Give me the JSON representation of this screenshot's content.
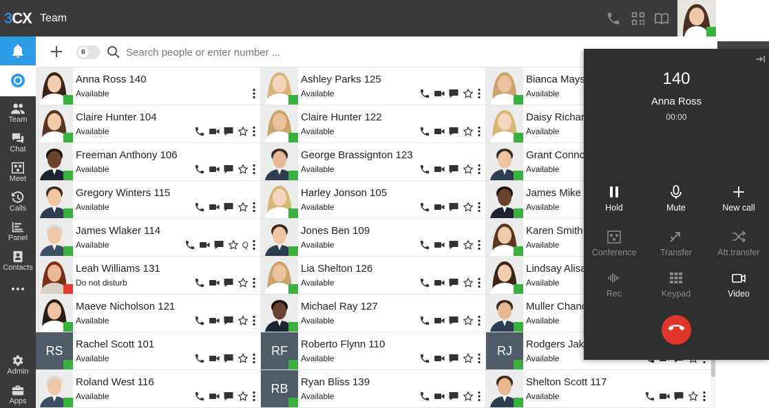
{
  "app": {
    "logo_prefix": "3",
    "logo_suffix": "CX",
    "title": "Team"
  },
  "colors": {
    "accent": "#2e9be6",
    "available": "#3ab03e",
    "dnd": "#e23b2e",
    "hangup": "#e0352b",
    "sidebar": "#3a3a3a",
    "panel": "#2f2f2f"
  },
  "sidebar": {
    "items": [
      {
        "label": "Team",
        "icon": "team-icon"
      },
      {
        "label": "Chat",
        "icon": "chat-icon"
      },
      {
        "label": "Meet",
        "icon": "meet-icon"
      },
      {
        "label": "Calls",
        "icon": "calls-icon"
      },
      {
        "label": "Panel",
        "icon": "panel-icon"
      },
      {
        "label": "Contacts",
        "icon": "contacts-icon"
      },
      {
        "label": "Admin",
        "icon": "gear-icon"
      },
      {
        "label": "Apps",
        "icon": "apps-icon"
      }
    ]
  },
  "toolbar": {
    "toggle_label": "B",
    "search_placeholder": "Search people or enter number ..."
  },
  "columns": [
    [
      {
        "name": "Anna Ross 140",
        "status": "Available",
        "initials": "",
        "avatar": "f1",
        "presence": "available",
        "actions": "more"
      },
      {
        "name": "Claire Hunter 104",
        "status": "Available",
        "initials": "",
        "avatar": "f2",
        "presence": "available",
        "actions": "full"
      },
      {
        "name": "Freeman Anthony 106",
        "status": "Available",
        "initials": "",
        "avatar": "m3",
        "presence": "available",
        "actions": "full"
      },
      {
        "name": "Gregory Winters 115",
        "status": "Available",
        "initials": "",
        "avatar": "m1",
        "presence": "available",
        "actions": "full"
      },
      {
        "name": "James Wlaker 114",
        "status": "Available",
        "initials": "",
        "avatar": "m4",
        "presence": "available",
        "actions": "fullq"
      },
      {
        "name": "Leah Williams 131",
        "status": "Do not disturb",
        "initials": "",
        "avatar": "f3",
        "presence": "dnd",
        "actions": "full"
      },
      {
        "name": "Maeve Nicholson 121",
        "status": "Available",
        "initials": "",
        "avatar": "f4",
        "presence": "available",
        "actions": "full"
      },
      {
        "name": "Rachel Scott 101",
        "status": "Available",
        "initials": "RS",
        "avatar": "",
        "presence": "available",
        "actions": "full"
      },
      {
        "name": "Roland West 116",
        "status": "Available",
        "initials": "",
        "avatar": "m4",
        "presence": "available",
        "actions": "full"
      }
    ],
    [
      {
        "name": "Ashley Parks 125",
        "status": "Available",
        "initials": "",
        "avatar": "f5",
        "presence": "available",
        "actions": "full"
      },
      {
        "name": "Claire Hunter 122",
        "status": "Available",
        "initials": "",
        "avatar": "f6",
        "presence": "available",
        "actions": "full"
      },
      {
        "name": "George Brassignton 123",
        "status": "Available",
        "initials": "",
        "avatar": "m2",
        "presence": "available",
        "actions": "full"
      },
      {
        "name": "Harley Jonson 105",
        "status": "Available",
        "initials": "",
        "avatar": "f5",
        "presence": "available",
        "actions": "full"
      },
      {
        "name": "Jones Ben 109",
        "status": "Available",
        "initials": "",
        "avatar": "m1",
        "presence": "available",
        "actions": "full"
      },
      {
        "name": "Lia Shelton 126",
        "status": "Available",
        "initials": "",
        "avatar": "f6",
        "presence": "available",
        "actions": "full"
      },
      {
        "name": "Michael Ray 127",
        "status": "Available",
        "initials": "",
        "avatar": "m3",
        "presence": "available",
        "actions": "full"
      },
      {
        "name": "Roberto Flynn 110",
        "status": "Available",
        "initials": "RF",
        "avatar": "",
        "presence": "available",
        "actions": "full"
      },
      {
        "name": "Ryan Bliss 139",
        "status": "Available",
        "initials": "RB",
        "avatar": "",
        "presence": "available",
        "actions": "full"
      }
    ],
    [
      {
        "name": "Bianca Mays",
        "status": "Available",
        "initials": "",
        "avatar": "f6",
        "presence": "available",
        "actions": "full"
      },
      {
        "name": "Daisy Richar",
        "status": "Available",
        "initials": "",
        "avatar": "f5",
        "presence": "available",
        "actions": "full"
      },
      {
        "name": "Grant Conno",
        "status": "Available",
        "initials": "",
        "avatar": "m1",
        "presence": "available",
        "actions": "full"
      },
      {
        "name": "James Mike",
        "status": "Available",
        "initials": "",
        "avatar": "m3",
        "presence": "available",
        "actions": "full"
      },
      {
        "name": "Karen Smith",
        "status": "Available",
        "initials": "",
        "avatar": "f2",
        "presence": "available",
        "actions": "full"
      },
      {
        "name": "Lindsay Alisa",
        "status": "Available",
        "initials": "",
        "avatar": "f1",
        "presence": "available",
        "actions": "full"
      },
      {
        "name": "Muller Chanc",
        "status": "Available",
        "initials": "",
        "avatar": "m2",
        "presence": "available",
        "actions": "full"
      },
      {
        "name": "Rodgers Jak",
        "status": "Available",
        "initials": "RJ",
        "avatar": "",
        "presence": "available",
        "actions": "full"
      },
      {
        "name": "Shelton Scott 117",
        "status": "Available",
        "initials": "",
        "avatar": "m2",
        "presence": "available",
        "actions": "full"
      }
    ]
  ],
  "call": {
    "number": "140",
    "name": "Anna Ross",
    "timer": "00:00",
    "buttons": [
      {
        "label": "Hold",
        "icon": "pause-icon",
        "enabled": true
      },
      {
        "label": "Mute",
        "icon": "microphone-icon",
        "enabled": true
      },
      {
        "label": "New call",
        "icon": "plus-icon",
        "enabled": true
      },
      {
        "label": "Conference",
        "icon": "conference-icon",
        "enabled": false
      },
      {
        "label": "Transfer",
        "icon": "transfer-icon",
        "enabled": false
      },
      {
        "label": "Att.transfer",
        "icon": "shuffle-icon",
        "enabled": false
      },
      {
        "label": "Rec",
        "icon": "waveform-icon",
        "enabled": false
      },
      {
        "label": "Keypad",
        "icon": "keypad-icon",
        "enabled": false
      },
      {
        "label": "Video",
        "icon": "video-icon",
        "enabled": true
      }
    ]
  }
}
